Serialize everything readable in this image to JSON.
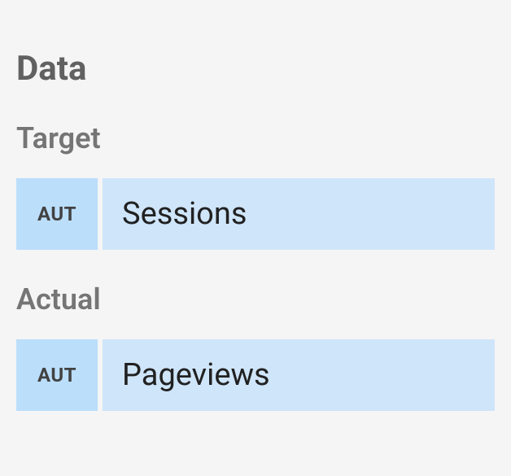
{
  "section": {
    "title": "Data"
  },
  "fields": {
    "target": {
      "label": "Target",
      "badge": "AUT",
      "value": "Sessions"
    },
    "actual": {
      "label": "Actual",
      "badge": "AUT",
      "value": "Pageviews"
    }
  }
}
